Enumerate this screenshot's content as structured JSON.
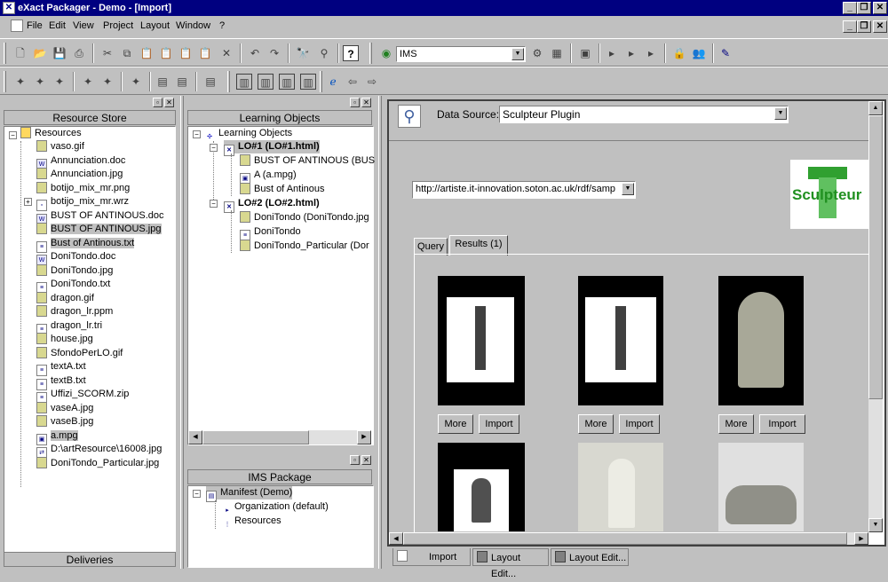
{
  "window": {
    "title": "eXact Packager - Demo - [Import]"
  },
  "menu": [
    "File",
    "Edit",
    "View",
    "Project",
    "Layout",
    "Window",
    "?"
  ],
  "toolbar": {
    "profile_value": "IMS"
  },
  "resource_store": {
    "title": "Resource Store",
    "root": "Resources",
    "items": [
      {
        "label": "vaso.gif",
        "icon": "image"
      },
      {
        "label": "Annunciation.doc",
        "icon": "word-doc"
      },
      {
        "label": "Annunciation.jpg",
        "icon": "image"
      },
      {
        "label": "botijo_mix_mr.png",
        "icon": "image"
      },
      {
        "label": "botijo_mix_mr.wrz",
        "icon": "file"
      },
      {
        "label": "BUST OF ANTINOUS.doc",
        "icon": "word-doc"
      },
      {
        "label": "BUST OF ANTINOUS.jpg",
        "icon": "image"
      },
      {
        "label": "Bust of Antinous.txt",
        "icon": "text"
      },
      {
        "label": "DoniTondo.doc",
        "icon": "word-doc"
      },
      {
        "label": "DoniTondo.jpg",
        "icon": "image"
      },
      {
        "label": "DoniTondo.txt",
        "icon": "text"
      },
      {
        "label": "dragon.gif",
        "icon": "image"
      },
      {
        "label": "dragon_lr.ppm",
        "icon": "image"
      },
      {
        "label": "dragon_lr.tri",
        "icon": "text"
      },
      {
        "label": "house.jpg",
        "icon": "image"
      },
      {
        "label": "SfondoPerLO.gif",
        "icon": "image"
      },
      {
        "label": "textA.txt",
        "icon": "text"
      },
      {
        "label": "textB.txt",
        "icon": "text"
      },
      {
        "label": "Uffizi_SCORM.zip",
        "icon": "text"
      },
      {
        "label": "vaseA.jpg",
        "icon": "image"
      },
      {
        "label": "vaseB.jpg",
        "icon": "image"
      },
      {
        "label": "a.mpg",
        "icon": "video"
      },
      {
        "label": "D:\\artResource\\16008.jpg",
        "icon": "link"
      },
      {
        "label": "DoniTondo_Particular.jpg",
        "icon": "image"
      }
    ],
    "footer": "Deliveries"
  },
  "learning_objects": {
    "title": "Learning Objects",
    "root": "Learning Objects",
    "lo1": {
      "label": "LO#1 (LO#1.html)",
      "children": [
        "BUST OF ANTINOUS (BUS",
        "A (a.mpg)",
        "Bust of Antinous"
      ]
    },
    "lo2": {
      "label": "LO#2 (LO#2.html)",
      "children": [
        "DoniTondo (DoniTondo.jpg",
        "DoniTondo",
        "DoniTondo_Particular (Dor"
      ]
    }
  },
  "ims_package": {
    "title": "IMS Package",
    "manifest": "Manifest (Demo)",
    "organization": "Organization (default)",
    "resources": "Resources"
  },
  "import": {
    "data_source_label": "Data Source:",
    "data_source_value": "Sculpteur Plugin",
    "url_value": "http://artiste.it-innovation.soton.ac.uk/rdf/samp",
    "logo_text": "Sculpteur",
    "tabs": [
      "Query",
      "Results (1)"
    ],
    "more_label": "More",
    "import_label": "Import"
  },
  "bottom_tabs": [
    "Import",
    "Layout Edit...",
    "Layout Edit..."
  ]
}
